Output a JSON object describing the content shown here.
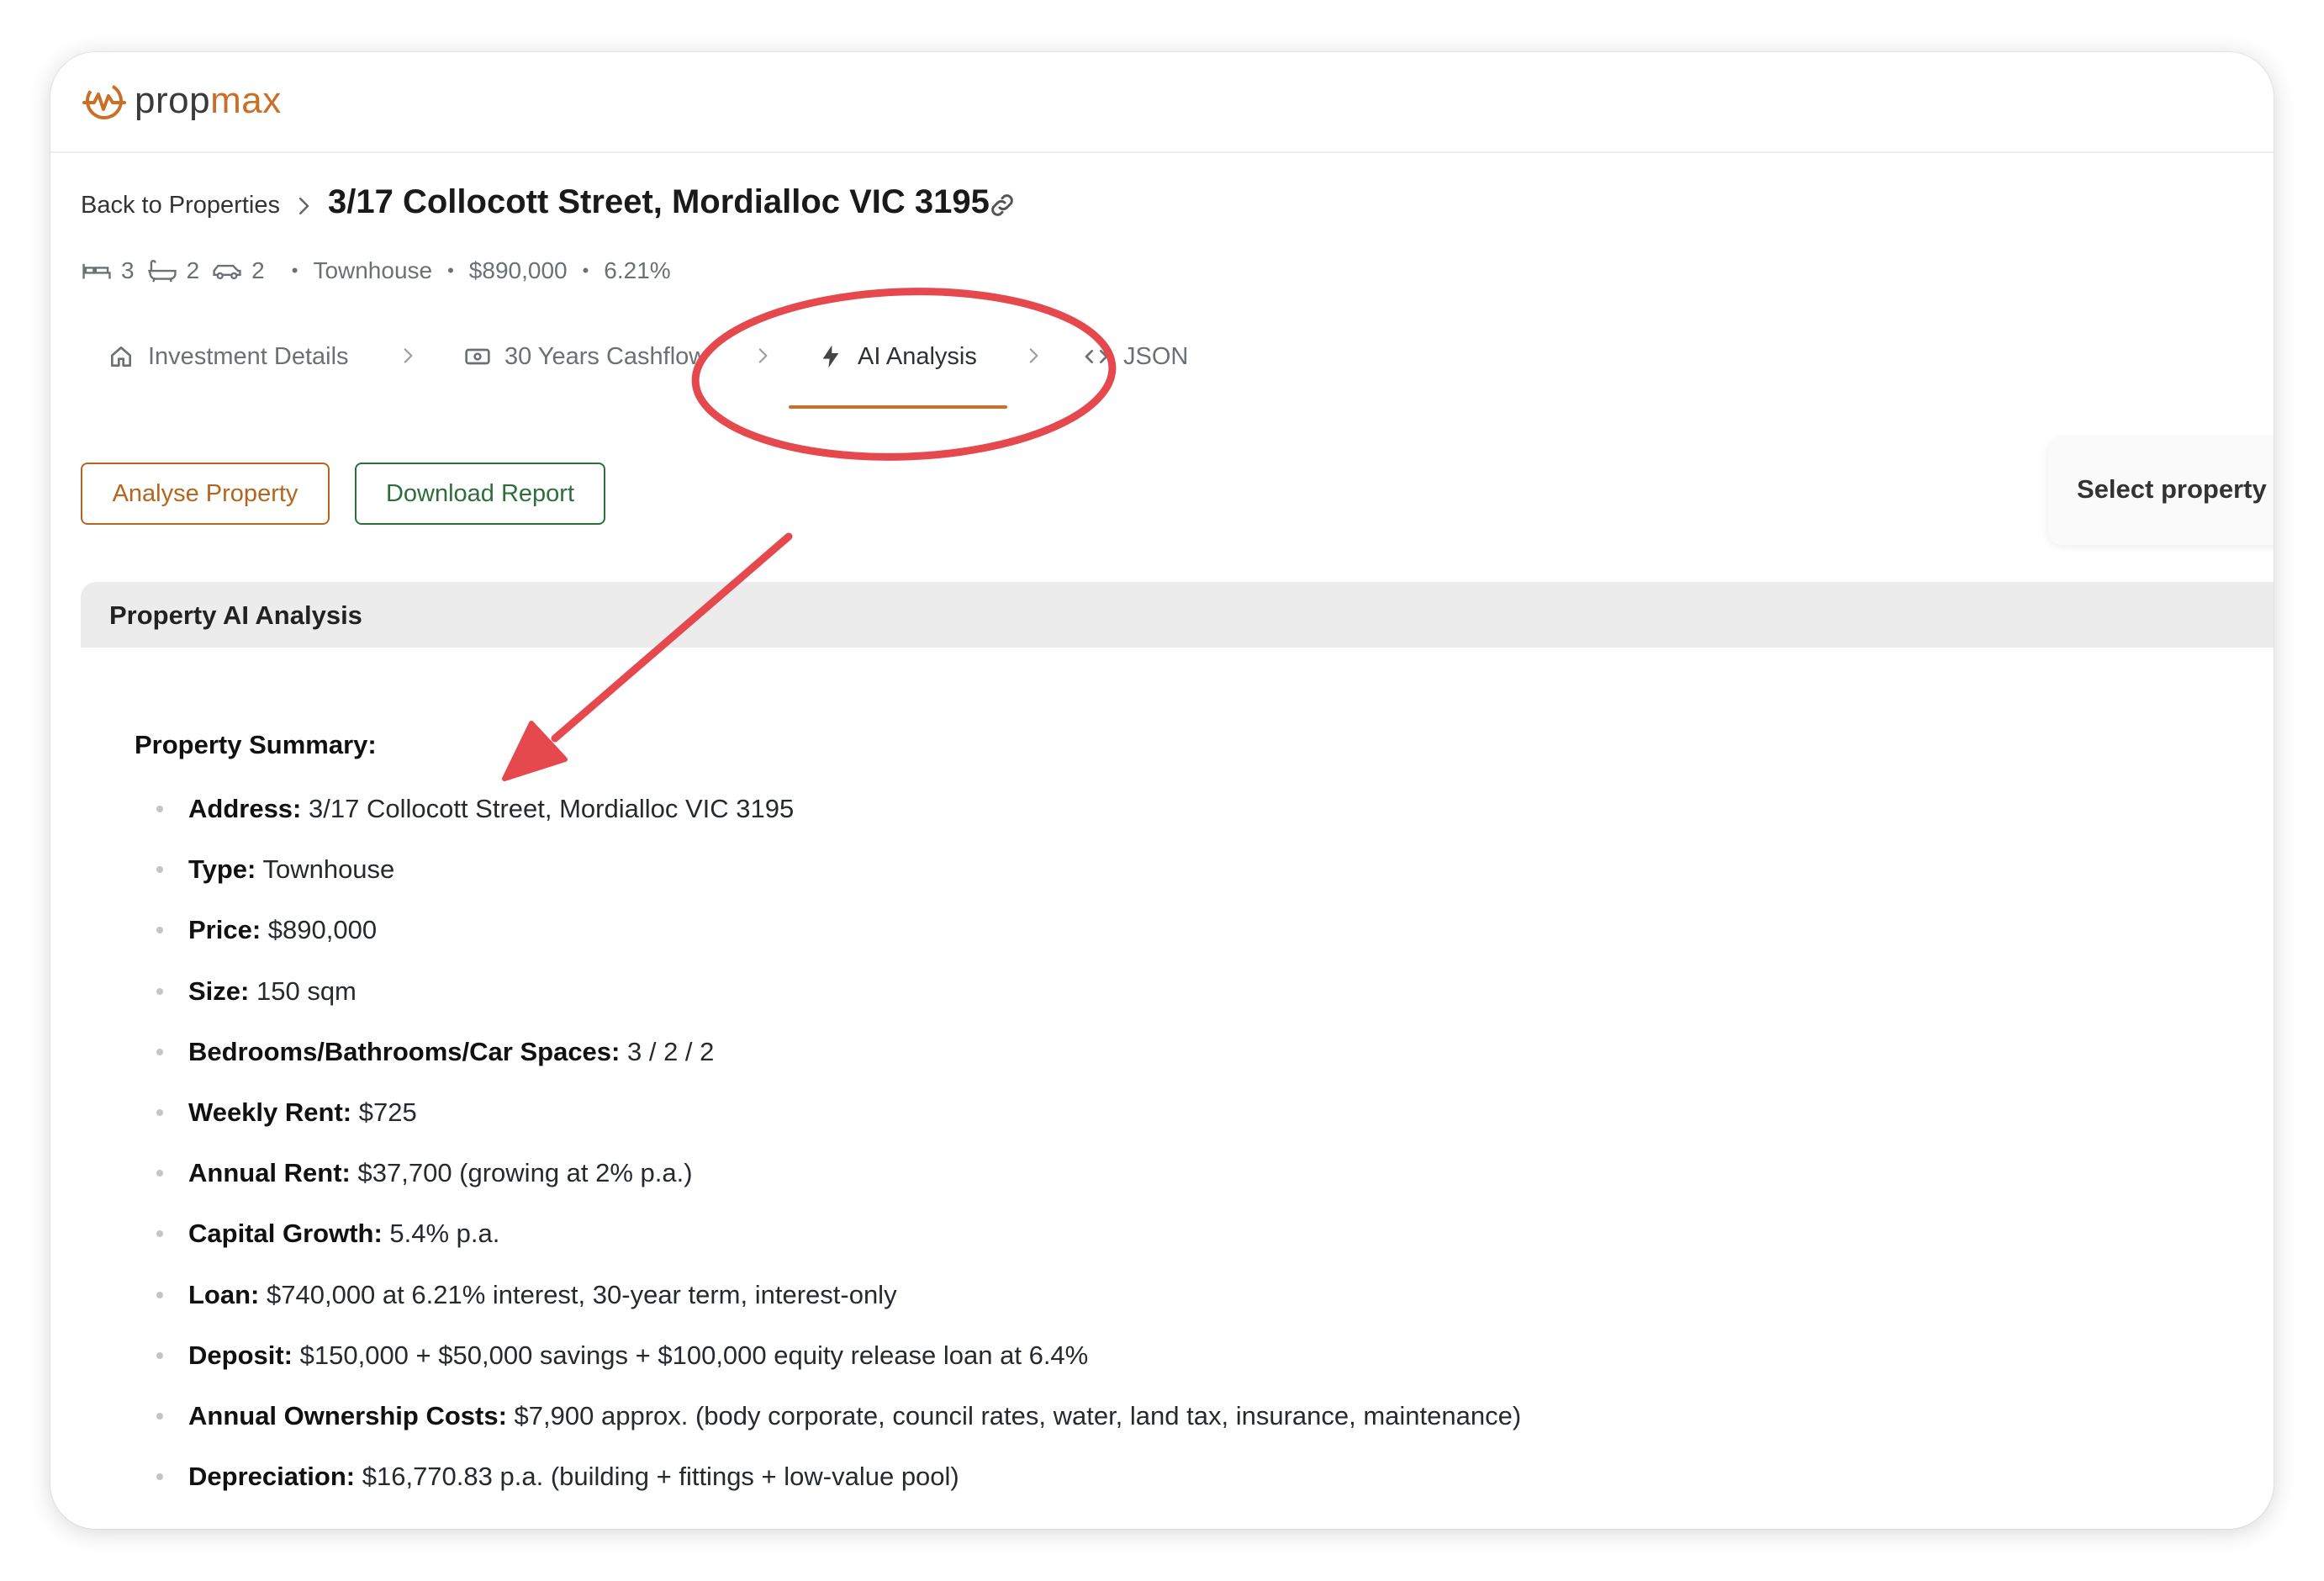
{
  "brand": {
    "prop": "prop",
    "max": "max",
    "accent": "#c8702a"
  },
  "breadcrumb": {
    "back_label": "Back to Properties",
    "title": "3/17 Collocott Street, Mordialloc VIC 3195"
  },
  "meta": {
    "beds": "3",
    "baths": "2",
    "cars": "2",
    "type": "Townhouse",
    "price": "$890,000",
    "rate": "6.21%"
  },
  "tabs": [
    {
      "label": "Investment Details",
      "icon": "home-icon"
    },
    {
      "label": "30 Years Cashflow",
      "icon": "cash-icon"
    },
    {
      "label": "AI Analysis",
      "icon": "bolt-icon",
      "active": true
    },
    {
      "label": "JSON",
      "icon": "code-icon"
    }
  ],
  "actions": {
    "analyse_label": "Analyse Property",
    "download_label": "Download Report"
  },
  "select_property_label": "Select property",
  "panel": {
    "title": "Property AI Analysis",
    "summary_heading": "Property Summary:"
  },
  "summary": [
    {
      "label": "Address:",
      "value": "3/17 Collocott Street, Mordialloc VIC 3195"
    },
    {
      "label": "Type:",
      "value": "Townhouse"
    },
    {
      "label": "Price:",
      "value": "$890,000"
    },
    {
      "label": "Size:",
      "value": "150 sqm"
    },
    {
      "label": "Bedrooms/Bathrooms/Car Spaces:",
      "value": "3 / 2 / 2"
    },
    {
      "label": "Weekly Rent:",
      "value": "$725"
    },
    {
      "label": "Annual Rent:",
      "value": "$37,700 (growing at 2% p.a.)"
    },
    {
      "label": "Capital Growth:",
      "value": "5.4% p.a."
    },
    {
      "label": "Loan:",
      "value": "$740,000 at 6.21% interest, 30-year term, interest-only"
    },
    {
      "label": "Deposit:",
      "value": "$150,000 + $50,000 savings + $100,000 equity release loan at 6.4%"
    },
    {
      "label": "Annual Ownership Costs:",
      "value": "$7,900 approx. (body corporate, council rates, water, land tax, insurance, maintenance)"
    },
    {
      "label": "Depreciation:",
      "value": "$16,770.83 p.a. (building + fittings + low-value pool)"
    }
  ],
  "annotation_color": "#e5484d"
}
